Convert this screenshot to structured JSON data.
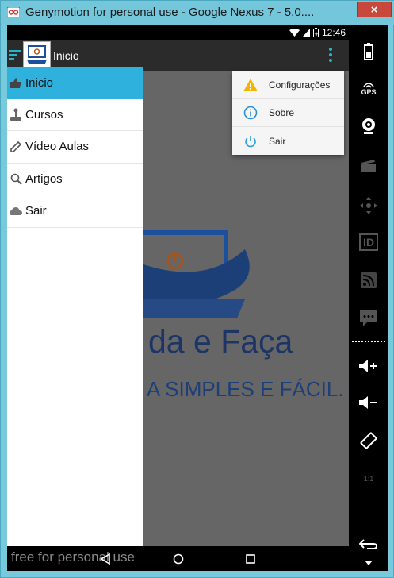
{
  "window": {
    "title": "Genymotion for personal use - Google Nexus 7 - 5.0....",
    "close_label": "×"
  },
  "statusbar": {
    "time": "12:46"
  },
  "appbar": {
    "title": "Inicio"
  },
  "drawer": {
    "items": [
      {
        "label": "Inicio",
        "icon": "thumbs-up-icon",
        "active": true
      },
      {
        "label": "Cursos",
        "icon": "joystick-icon"
      },
      {
        "label": "Vídeo Aulas",
        "icon": "pencil-icon"
      },
      {
        "label": "Artigos",
        "icon": "search-icon"
      },
      {
        "label": "Sair",
        "icon": "cloud-icon"
      }
    ]
  },
  "popup": {
    "items": [
      {
        "label": "Configurações",
        "icon": "warning-icon"
      },
      {
        "label": "Sobre",
        "icon": "info-icon"
      },
      {
        "label": "Sair",
        "icon": "power-icon"
      }
    ]
  },
  "splash": {
    "line1": "da e Faça",
    "line2": "A SIMPLES E FÁCIL."
  },
  "watermark": "free for personal use",
  "toolbar": {
    "gps_label": "GPS",
    "id_label": "ID",
    "scale_label": "1:1"
  },
  "colors": {
    "accent": "#2ab3c7",
    "drawer_active": "#2fb1de",
    "brand_blue": "#1c3566"
  }
}
